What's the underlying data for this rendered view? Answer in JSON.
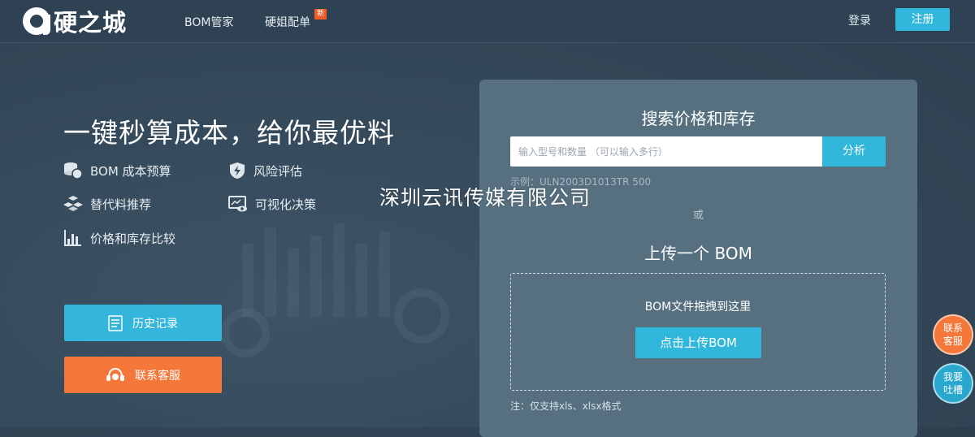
{
  "header": {
    "logo_text": "硬之城",
    "nav": [
      {
        "label": "BOM管家"
      },
      {
        "label": "硬姐配单",
        "badge": "新"
      }
    ],
    "login_label": "登录",
    "register_label": "注册"
  },
  "hero": {
    "title": "一键秒算成本，给你最优料",
    "features": [
      {
        "label": "BOM 成本预算",
        "icon": "coins-icon"
      },
      {
        "label": "风险评估",
        "icon": "shield-bolt-icon"
      },
      {
        "label": "替代料推荐",
        "icon": "cubes-icon"
      },
      {
        "label": "可视化决策",
        "icon": "monitor-eye-icon"
      },
      {
        "label": "价格和库存比较",
        "icon": "bar-chart-icon"
      }
    ],
    "history_button": "历史记录",
    "service_button": "联系客服"
  },
  "watermark": "深圳云讯传媒有限公司",
  "panel": {
    "search_title": "搜索价格和库存",
    "search_placeholder": "输入型号和数量 （可以输入多行）",
    "analyze_button": "分析",
    "example": "示例：ULN2003D1013TR  500",
    "or": "或",
    "upload_title": "上传一个 BOM",
    "drop_text": "BOM文件拖拽到这里",
    "upload_button": "点击上传BOM",
    "note": "注：仅支持xls、xlsx格式"
  },
  "side": {
    "service": "联系客服",
    "feedback": "我要吐槽"
  },
  "colors": {
    "accent": "#31b6dc",
    "orange": "#f6773a",
    "badge": "#f25b24",
    "panel": "#56707f"
  }
}
